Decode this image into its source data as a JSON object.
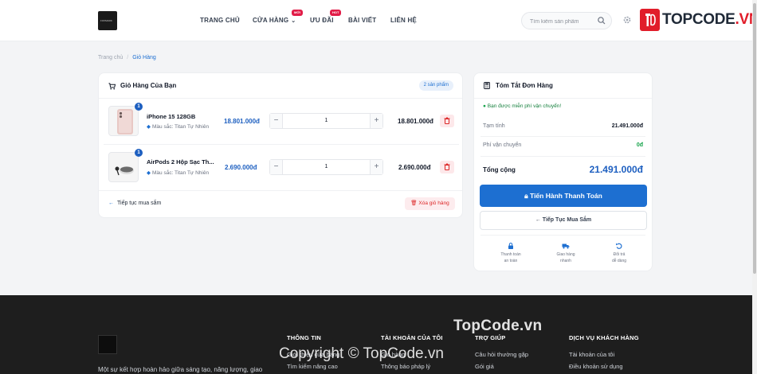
{
  "header": {
    "logo_text": "FOXMARK",
    "nav": [
      {
        "label": "TRANG CHỦ"
      },
      {
        "label": "CỬA HÀNG",
        "badge": "MỚI"
      },
      {
        "label": "ƯU ĐÃI",
        "badge": "HOT"
      },
      {
        "label": "BÀI VIẾT"
      },
      {
        "label": "LIÊN HỆ"
      }
    ],
    "search_placeholder": "Tìm kiếm sản phẩm",
    "brand_prefix": "TOPCODE",
    "brand_suffix": ".VN"
  },
  "breadcrumb": {
    "home": "Trang chủ",
    "separator": "/",
    "current": "Giỏ Hàng"
  },
  "cart": {
    "title": "Giỏ Hàng Của Bạn",
    "count_label": "2 sản phẩm",
    "items": [
      {
        "name": "iPhone 15 128GB",
        "color": "Màu sắc: Titan Tự Nhiên",
        "unit_price": "18.801.000đ",
        "qty": "1",
        "total": "18.801.000đ",
        "badge": "1"
      },
      {
        "name": "AirPods 2 Hộp Sạc Th...",
        "color": "Màu sắc: Titan Tự Nhiên",
        "unit_price": "2.690.000đ",
        "qty": "1",
        "total": "2.690.000đ",
        "badge": "1"
      }
    ],
    "continue_label": "Tiếp tục mua sắm",
    "clear_label": "Xóa giỏ hàng"
  },
  "summary": {
    "title": "Tóm Tắt Đơn Hàng",
    "free_shipping": "Bạn được miễn phí vận chuyển!",
    "subtotal_label": "Tạm tính",
    "subtotal_value": "21.491.000đ",
    "shipping_label": "Phí vận chuyển",
    "shipping_value": "0đ",
    "total_label": "Tổng cộng",
    "total_value": "21.491.000đ",
    "checkout_label": "Tiến Hành Thanh Toán",
    "continue_label": "Tiếp Tục Mua Sắm",
    "features": [
      {
        "line1": "Thanh toán",
        "line2": "an toàn"
      },
      {
        "line1": "Giao hàng",
        "line2": "nhanh"
      },
      {
        "line1": "Đổi trả",
        "line2": "dễ dàng"
      }
    ]
  },
  "footer": {
    "description": "Một sự kết hợp hoàn hảo giữa sáng tạo, năng lượng, giao",
    "columns": [
      {
        "title": "THÔNG TIN",
        "links": [
          "Giới thiệu cửa hàng",
          "Tìm kiếm nâng cao"
        ]
      },
      {
        "title": "TÀI KHOẢN CỦA TÔI",
        "links": [
          "Giỏ hàng",
          "Thông báo pháp lý"
        ]
      },
      {
        "title": "TRỢ GIÚP",
        "links": [
          "Câu hỏi thường gặp",
          "Gói giá"
        ]
      },
      {
        "title": "DỊCH VỤ KHÁCH HÀNG",
        "links": [
          "Tài khoản của tôi",
          "Điều khoản sử dụng"
        ]
      }
    ]
  },
  "watermarks": {
    "top": "TopCode.vn",
    "bottom": "Copyright © TopCode.vn"
  }
}
